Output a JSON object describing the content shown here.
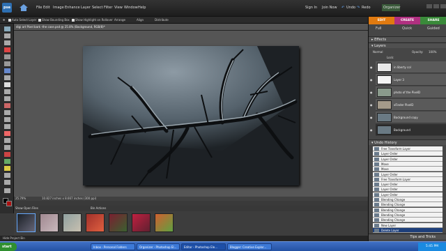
{
  "app": {
    "logo": "pse"
  },
  "menu": [
    "File",
    "Edit",
    "Image",
    "Enhance",
    "Layer",
    "Select",
    "Filter",
    "View",
    "Window",
    "Help"
  ],
  "menu_right": [
    "Sign In",
    "Join Now",
    "Undo",
    "Redo",
    "Organizer"
  ],
  "options": [
    "Auto Select Layer",
    "Show Bounding Box",
    "Show Highlight on Rollover",
    "Arrange",
    "Align",
    "Distribute"
  ],
  "doc_tab": "digi art Pixel bark -the case.psd @ 25.8% (Background, RGB/8)*",
  "status": {
    "zoom": "25.79%",
    "info": "10.827 inches x 8.667 inches (300 ppi)"
  },
  "bin": {
    "show_label": "Show Open Files",
    "actions_label": "Bin Actions",
    "hide_label": "Hide Project Bin",
    "thumbs": [
      {
        "c1": "#1b2026",
        "c2": "#667"
      },
      {
        "c1": "#a08890",
        "c2": "#c8b8bc"
      },
      {
        "c1": "#8fa0a0",
        "c2": "#c8c0b0"
      },
      {
        "c1": "#a0302a",
        "c2": "#e06040"
      },
      {
        "c1": "#7a2030",
        "c2": "#3a6030"
      },
      {
        "c1": "#c02040",
        "c2": "#602030"
      },
      {
        "c1": "#d06030",
        "c2": "#60a040"
      }
    ]
  },
  "modes": [
    {
      "label": "EDIT",
      "color": "#e07a10"
    },
    {
      "label": "CREATE",
      "color": "#b03080"
    },
    {
      "label": "SHARE",
      "color": "#3a8a3a"
    }
  ],
  "subtabs": [
    "Full",
    "Quick",
    "Guided"
  ],
  "panels": {
    "effects": "Effects",
    "layers": "Layers",
    "blend": "Normal",
    "opacity": "Opacity:",
    "opacity_val": "100%",
    "lock": "Lock:",
    "history": "Undo History",
    "tips": "Tips and Tricks"
  },
  "layers": [
    {
      "name": "in liberty col",
      "c": "#e8e8e8"
    },
    {
      "name": "Layer 3",
      "c": "#f4f4f4"
    },
    {
      "name": "photo of the PixelD",
      "c": "#8a9a8c"
    },
    {
      "name": "xFinder PixelD",
      "c": "#a49a8a"
    },
    {
      "name": "Background copy",
      "c": "#6a7a84"
    },
    {
      "name": "Background",
      "c": "#6a7a84"
    }
  ],
  "history": [
    "Free Transform Layer",
    "Layer Order",
    "Layer Order",
    "Move",
    "Move",
    "Layer Order",
    "Free Transform Layer",
    "Layer Order",
    "Layer Order",
    "Layer Order",
    "Blending Change",
    "Blending Change",
    "Blending Change",
    "Blending Change",
    "Blending Change",
    "New Layer",
    "Delete Layer"
  ],
  "taskbar": {
    "start": "start",
    "clock": "5:45 PM",
    "tasks": [
      "Inbox - Personal Folders",
      "Organizer - Photoshop El...",
      "Editor - Photoshop Ele...",
      "Blogger: Creative Explor..."
    ]
  }
}
